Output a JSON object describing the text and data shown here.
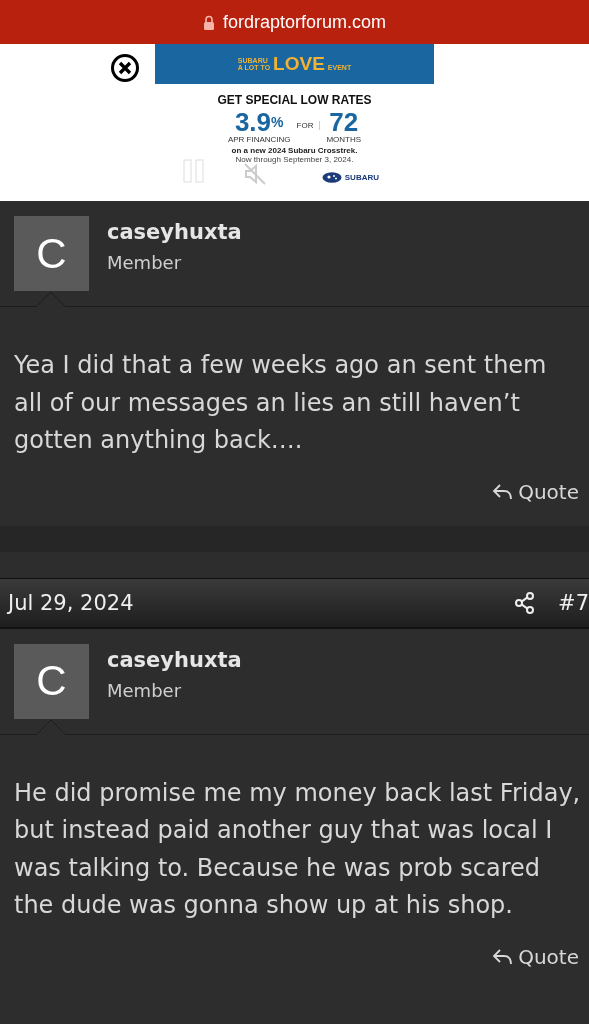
{
  "address_bar": {
    "url": "fordraptorforum.com"
  },
  "ad": {
    "brand_top": "SUBARU",
    "brand_line": "A LOT TO",
    "love": "LOVE",
    "event": "EVENT",
    "headline": "GET SPECIAL LOW RATES",
    "rate": "3.9",
    "percent": "%",
    "rate_label": "APR FINANCING",
    "for": "FOR",
    "months": "72",
    "months_label": "MONTHS",
    "offer": "on a new 2024 Subaru Crosstrek.",
    "dates": "Now through September 3, 2024.",
    "logo": "SUBARU"
  },
  "posts": [
    {
      "avatar_letter": "C",
      "username": "caseyhuxta",
      "role": "Member",
      "message": "Yea I did that a few weeks ago an sent them all of our messages an lies an still haven’t gotten anything back….",
      "quote": "Quote"
    },
    {
      "date": "Jul 29, 2024",
      "number": "#7",
      "avatar_letter": "C",
      "username": "caseyhuxta",
      "role": "Member",
      "message": "He did promise me my money back last Friday, but instead paid another guy that was local I was talking to. Because he was prob scared the dude was gonna show up at his shop.",
      "quote": "Quote"
    }
  ]
}
